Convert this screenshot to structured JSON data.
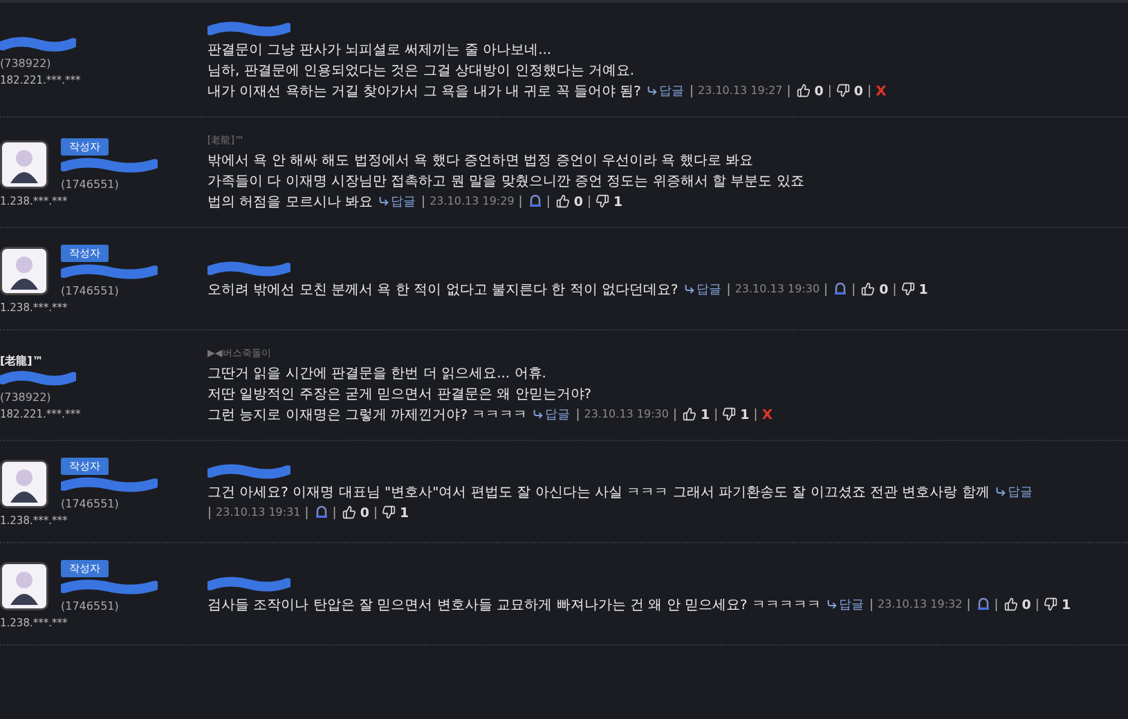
{
  "comments": [
    {
      "author": {
        "writer": false,
        "avatar": false,
        "uid": "(738922)",
        "ip": "182.221.***.***"
      },
      "lines": [
        "판결문이 그냥 판사가 뇌피셜로 써제끼는 줄 아나보네...",
        "님하, 판결문에 인용되었다는 것은 그걸 상대방이 인정했다는 거예요.",
        "내가 이재선 욕하는 거길 찾아가서 그 욕을 내가 내 귀로 꼭 들어야 됨?"
      ],
      "meta": {
        "reply": "답글",
        "separator": "|",
        "date": "23.10.13 19:27",
        "report": false,
        "likes": "0",
        "dislikes": "0",
        "delete": "X"
      }
    },
    {
      "author": {
        "writer": true,
        "badge": "작성자",
        "avatar": true,
        "uid": "(1746551)",
        "ip": "1.238.***.***"
      },
      "reply_to": "[老龍]™",
      "lines": [
        "밖에서 욕 안 해싸 해도 법정에서 욕 했다 증언하면 법정 증언이 우선이라 욕 했다로 봐요",
        "가족들이 다 이재명 시장님만 접촉하고 뭔 말을 맞췄으니깐 증언 정도는 위증해서 할 부분도 있죠",
        "법의 허점을 모르시나 봐요"
      ],
      "meta": {
        "reply": "답글",
        "separator": "|",
        "date": "23.10.13 19:29",
        "report": true,
        "likes": "0",
        "dislikes": "1"
      }
    },
    {
      "author": {
        "writer": true,
        "badge": "작성자",
        "avatar": true,
        "uid": "(1746551)",
        "ip": "1.238.***.***"
      },
      "lines": [
        "오히려 밖에선 모친 분께서 욕 한 적이 없다고 불지른다 한 적이 없다던데요?"
      ],
      "meta": {
        "reply": "답글",
        "separator": "|",
        "date": "23.10.13 19:30",
        "report": true,
        "likes": "0",
        "dislikes": "1"
      }
    },
    {
      "author": {
        "writer": false,
        "avatar": false,
        "name": "[老龍]™",
        "uid": "(738922)",
        "ip": "182.221.***.***"
      },
      "reply_to": "▶◀버스죽돌이",
      "lines": [
        "그딴거 읽을 시간에 판결문을 한번 더 읽으세요... 어휴.",
        "저딴 일방적인 주장은 굳게 믿으면서 판결문은 왜 안믿는거야?",
        "그런 능지로 이재명은 그렇게 까제낀거야? ㅋㅋㅋㅋ"
      ],
      "meta": {
        "reply": "답글",
        "separator": "|",
        "date": "23.10.13 19:30",
        "report": false,
        "likes": "1",
        "dislikes": "1",
        "delete": "X"
      }
    },
    {
      "author": {
        "writer": true,
        "badge": "작성자",
        "avatar": true,
        "uid": "(1746551)",
        "ip": "1.238.***.***"
      },
      "lines": [
        "그건 아세요? 이재명 대표님 \"변호사\"여서 편법도 잘 아신다는 사실 ㅋㅋㅋ 그래서 파기환송도 잘 이끄셨죠 전관 변호사랑 함께"
      ],
      "meta": {
        "reply": "답글",
        "separator": "|",
        "date": "23.10.13 19:31",
        "report": true,
        "likes": "0",
        "dislikes": "1"
      }
    },
    {
      "author": {
        "writer": true,
        "badge": "작성자",
        "avatar": true,
        "uid": "(1746551)",
        "ip": "1.238.***.***"
      },
      "lines": [
        "검사들 조작이나 탄압은 잘 믿으면서 변호사들 교묘하게 빠져나가는 건 왜 안 믿으세요? ㅋㅋㅋㅋㅋ"
      ],
      "meta": {
        "reply": "답글",
        "separator": "|",
        "date": "23.10.13 19:32",
        "report": true,
        "likes": "0",
        "dislikes": "1"
      }
    }
  ]
}
